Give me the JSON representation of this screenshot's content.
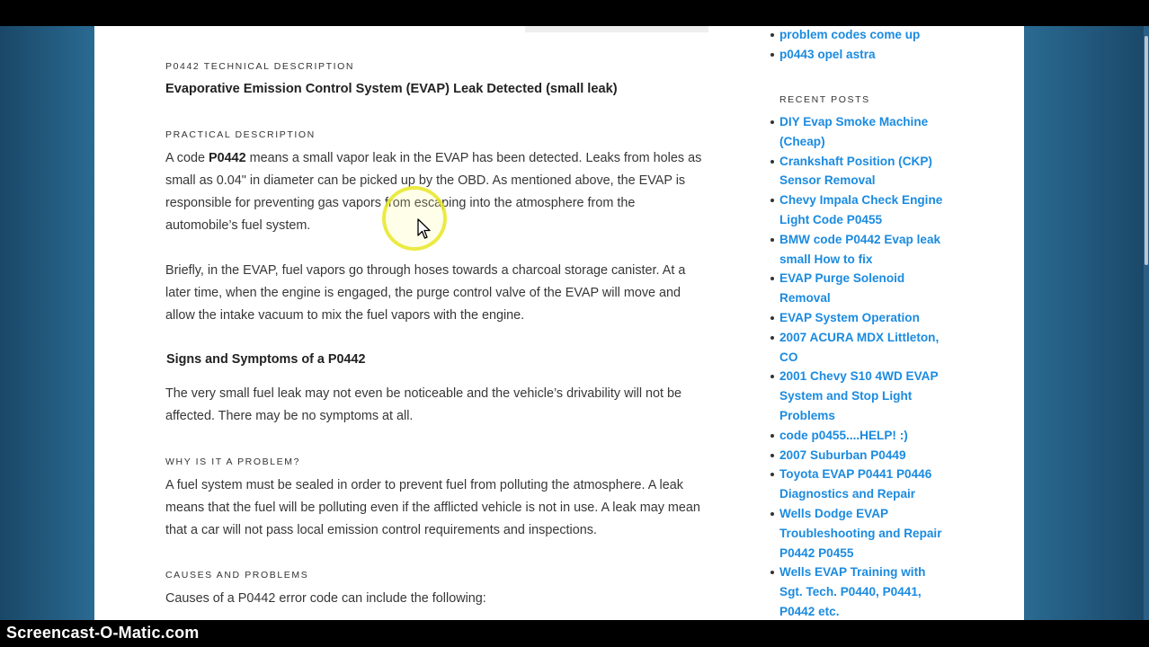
{
  "recorder": {
    "watermark": "Screencast-O-Matic.com"
  },
  "article": {
    "technical_label": "P0442 TECHNICAL DESCRIPTION",
    "technical_title": "Evaporative Emission Control System (EVAP) Leak Detected (small leak)",
    "practical_label": "PRACTICAL DESCRIPTION",
    "practical_p1_pre": "A code ",
    "practical_p1_code": "P0442",
    "practical_p1_post": " means a small vapor leak in the EVAP has been detected. Leaks from holes as small as 0.04\" in diameter can be picked up by the OBD.  As mentioned above, the EVAP is responsible for preventing gas vapors from escaping into the atmosphere from the automobile’s fuel system.",
    "practical_p2": "Briefly, in the EVAP, fuel vapors go through hoses towards a charcoal storage canister.  At a later time, when the engine is engaged, the purge control valve of the EVAP will move and allow the intake vacuum to mix the fuel vapors with the engine.",
    "symptoms_heading": "Signs and Symptoms of a P0442",
    "symptoms_p": "The very small fuel leak may not even be noticeable and the vehicle’s drivability will not be affected.  There may be no symptoms at all.",
    "problem_label": "WHY IS IT A PROBLEM?",
    "problem_p": "A fuel system must be sealed in order to prevent fuel from polluting the atmosphere.  A leak means that the fuel will be polluting even if the afflicted vehicle is not in use.  A leak may mean that a car will not pass local emission control requirements and inspections.",
    "causes_label": "CAUSES AND PROBLEMS",
    "causes_p": "Causes of a P0442 error code can include the following:"
  },
  "sidebar": {
    "top_links": [
      {
        "label": "problem codes come up"
      },
      {
        "label": "p0443 opel astra"
      }
    ],
    "recent_posts_title": "RECENT POSTS",
    "recent_posts": [
      {
        "label": "DIY Evap Smoke Machine (Cheap)"
      },
      {
        "label": "Crankshaft Position (CKP) Sensor Removal"
      },
      {
        "label": "Chevy Impala Check Engine Light Code P0455"
      },
      {
        "label": "BMW code P0442 Evap leak small How to fix"
      },
      {
        "label": "EVAP Purge Solenoid Removal"
      },
      {
        "label": "EVAP System Operation"
      },
      {
        "label": "2007 ACURA MDX Littleton, CO"
      },
      {
        "label": "2001 Chevy S10 4WD EVAP System and Stop Light Problems"
      },
      {
        "label": "code p0455....HELP! :)"
      },
      {
        "label": "2007 Suburban P0449"
      },
      {
        "label": "Toyota EVAP P0441 P0446 Diagnostics and Repair"
      },
      {
        "label": "Wells Dodge EVAP Troubleshooting and Repair P0442 P0455"
      },
      {
        "label": "Wells EVAP Training with Sgt. Tech. P0440, P0441, P0442 etc."
      }
    ]
  },
  "colors": {
    "link": "#1b8be0",
    "body_text": "#373737",
    "backdrop": "#1e4f72",
    "cursor_highlight": "#e8e828"
  }
}
